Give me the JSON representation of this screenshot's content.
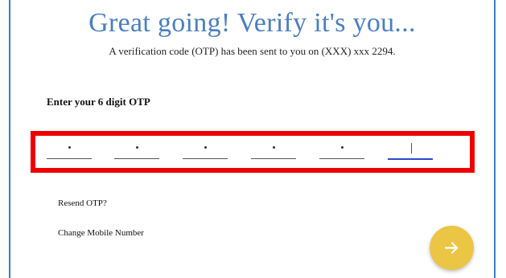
{
  "header": {
    "title": "Great going! Verify it's you...",
    "subtitle": "A verification code (OTP) has been sent to you on (XXX) xxx 2294."
  },
  "otp": {
    "label": "Enter your 6 digit OTP",
    "digit_count": 6,
    "digits": [
      "",
      "",
      "",
      "",
      "",
      ""
    ],
    "active_index": 5
  },
  "links": {
    "resend": "Resend OTP?",
    "change_number": "Change Mobile Number"
  },
  "submit_button": {
    "icon": "arrow-right-icon",
    "color": "#ebc544"
  },
  "colors": {
    "title": "#4a7fc1",
    "frame": "#3a7cc7",
    "highlight": "#ee0000",
    "active_underline": "#2b4bc8"
  }
}
